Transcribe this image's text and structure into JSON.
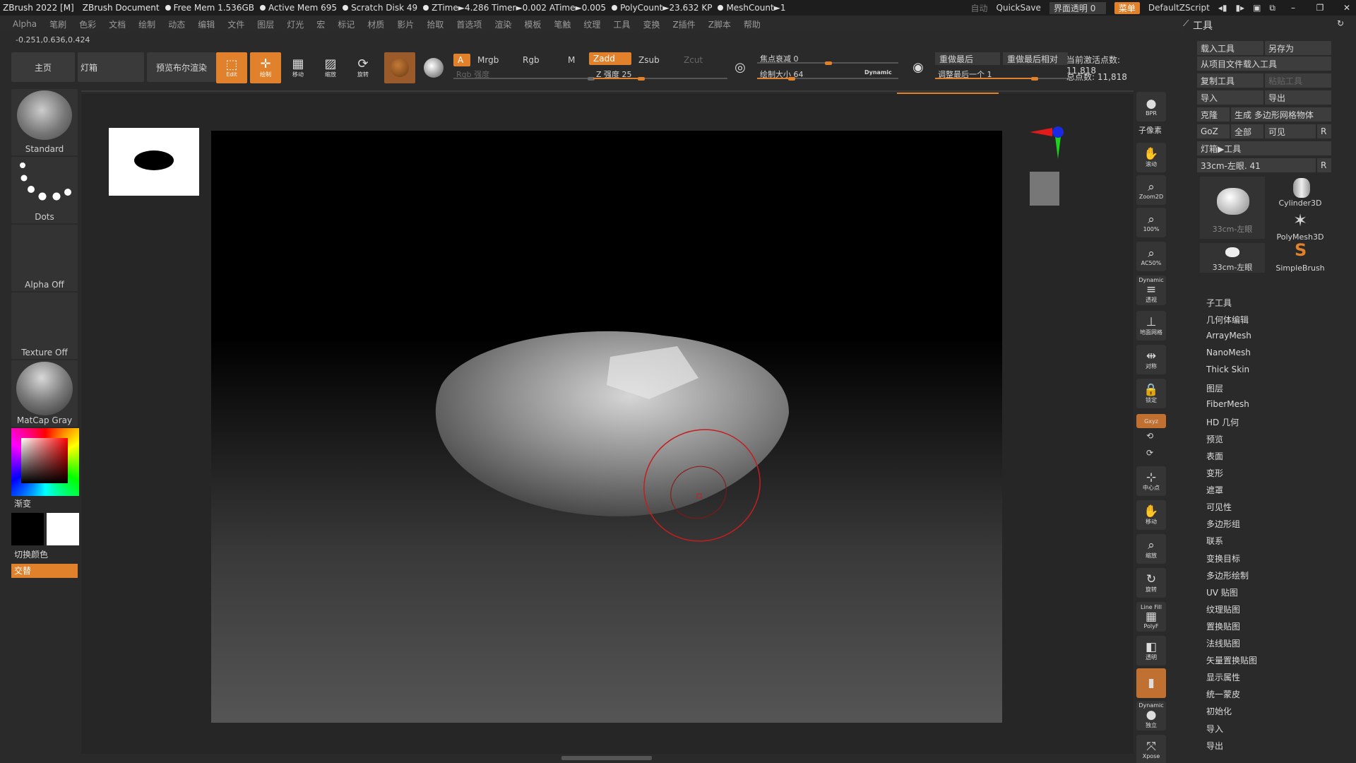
{
  "titlebar": {
    "app": "ZBrush 2022 [M]",
    "document": "ZBrush Document",
    "stats": [
      "Free Mem 1.536GB",
      "Active Mem 695",
      "Scratch Disk 49",
      "ZTime►4.286 Timer►0.002 ATime►0.005",
      "PolyCount►23.632 KP",
      "MeshCount►1"
    ],
    "auto_label": "自动",
    "quicksave": "QuickSave",
    "ui_transparency": "界面透明 0",
    "menu_chip": "菜单",
    "script": "DefaultZScript"
  },
  "menubar": {
    "items": [
      "Alpha",
      "笔刷",
      "色彩",
      "文档",
      "绘制",
      "动态",
      "编辑",
      "文件",
      "图层",
      "灯光",
      "宏",
      "标记",
      "材质",
      "影片",
      "拾取",
      "首选项",
      "渲染",
      "模板",
      "笔触",
      "纹理",
      "工具",
      "变换",
      "Z插件",
      "Z脚本",
      "帮助"
    ]
  },
  "coords": "-0.251,0.636,0.424",
  "shelf": {
    "tab_home": "主页",
    "tab_lightbox": "灯箱",
    "tab_bpr": "预览布尔渲染",
    "btn_edit": "Edit",
    "btn_draw": "绘制",
    "btn_move": "移动",
    "btn_scale": "缩放",
    "btn_rotate": "旋转",
    "a_chip": "A",
    "mrgb": "Mrgb",
    "rgb": "Rgb",
    "m": "M",
    "rgb_intensity": "Rgb 强度",
    "zadd": "Zadd",
    "zsub": "Zsub",
    "zcut": "Zcut",
    "z_intensity": "Z 强度 25",
    "z_intensity_value": 0.25,
    "focal_shift": "焦点衰减 0",
    "draw_size": "绘制大小 64",
    "dynamic": "Dynamic",
    "replay_last": "重做最后",
    "replay_last_rel": "重做最后相对",
    "adjust_last": "调整最后一个 1",
    "active_points": "当前激活点数: 11,818",
    "total_points": "总点数: 11,818"
  },
  "leftpanel": {
    "brush": "Standard",
    "stroke": "Dots",
    "alpha": "Alpha Off",
    "texture": "Texture Off",
    "material": "MatCap Gray",
    "gradient": "渐变",
    "switch_color": "切换颜色",
    "alternate": "交替"
  },
  "rightbar": {
    "bpr": "BPR",
    "subpixel": "子像素",
    "scroll": "滚动",
    "zoom2d": "Zoom2D",
    "p100": "100%",
    "ac50": "AC50%",
    "dynamic_persp": "Dynamic",
    "persp": "透视",
    "floor": "地面网格",
    "local": "对称",
    "lock": "锁定",
    "xyz": "Gxyz",
    "frame": "中心点",
    "move": "移动",
    "scale": "缩放",
    "rotate": "旋转",
    "linefill": "Line Fill",
    "polyf": "PolyF",
    "transp": "透明",
    "dynamic2": "Dynamic",
    "solo": "独立",
    "xpose": "Xpose"
  },
  "toolpanel": {
    "title": "工具",
    "load_tool": "载入工具",
    "save_as": "另存为",
    "load_from_project": "从项目文件载入工具",
    "copy_tool": "复制工具",
    "paste_tool": "粘贴工具",
    "import": "导入",
    "export": "导出",
    "clone": "克隆",
    "make_polymesh": "生成 多边形网格物体",
    "goz": "GoZ",
    "all": "全部",
    "visible": "可见",
    "r": "R",
    "lightbox_tools": "灯箱▶工具",
    "current_tool": "33cm-左眼. 41",
    "thumbs": [
      "33cm-左眼",
      "Cylinder3D",
      "PolyMesh3D",
      "33cm-左眼",
      "SimpleBrush"
    ],
    "sections": [
      "子工具",
      "几何体编辑",
      "ArrayMesh",
      "NanoMesh",
      "Thick Skin",
      "图层",
      "FiberMesh",
      "HD 几何",
      "预览",
      "表面",
      "变形",
      "遮罩",
      "可见性",
      "多边形组",
      "联系",
      "变换目标",
      "多边形绘制",
      "UV 贴图",
      "纹理贴图",
      "置换贴图",
      "法线贴图",
      "矢量置换贴图",
      "显示属性",
      "统一蒙皮",
      "初始化",
      "导入",
      "导出"
    ]
  },
  "colors": {
    "accent": "#e2812b",
    "brush_ring": "#c41e1e"
  }
}
